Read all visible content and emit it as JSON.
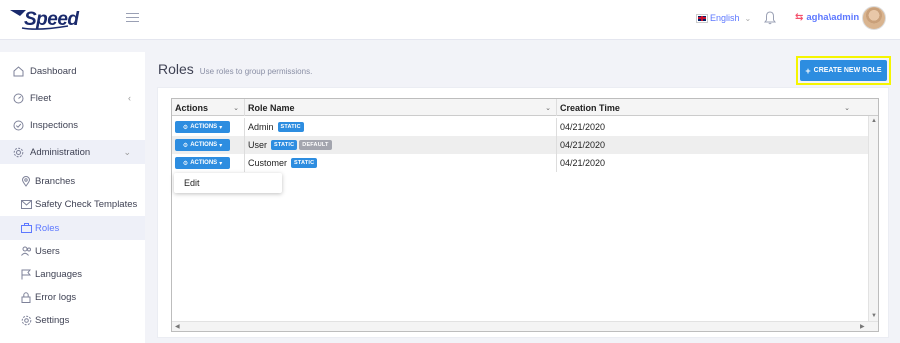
{
  "app": {
    "logo_text": "Speed"
  },
  "header": {
    "language": "English",
    "user": "agha\\admin"
  },
  "sidebar": {
    "items": [
      {
        "label": "Dashboard",
        "icon": "home-icon"
      },
      {
        "label": "Fleet",
        "icon": "speedometer-icon"
      },
      {
        "label": "Inspections",
        "icon": "check-circle-icon"
      },
      {
        "label": "Administration",
        "icon": "gear-icon"
      },
      {
        "label": "Branches",
        "icon": "map-pin-icon"
      },
      {
        "label": "Safety Check Templates",
        "icon": "envelope-icon"
      },
      {
        "label": "Roles",
        "icon": "briefcase-icon"
      },
      {
        "label": "Users",
        "icon": "users-icon"
      },
      {
        "label": "Languages",
        "icon": "flag-icon"
      },
      {
        "label": "Error logs",
        "icon": "lock-icon"
      },
      {
        "label": "Settings",
        "icon": "cog-icon"
      }
    ]
  },
  "page": {
    "title": "Roles",
    "subtitle": "Use roles to group permissions.",
    "create_button": "CREATE NEW ROLE",
    "create_plus": "+"
  },
  "grid": {
    "columns": [
      "Actions",
      "Role Name",
      "Creation Time"
    ],
    "action_label": "ACTIONS",
    "rows": [
      {
        "name": "Admin",
        "badges": [
          "STATIC"
        ],
        "created": "04/21/2020"
      },
      {
        "name": "User",
        "badges": [
          "STATIC",
          "DEFAULT"
        ],
        "created": "04/21/2020"
      },
      {
        "name": "Customer",
        "badges": [
          "STATIC"
        ],
        "created": "04/21/2020"
      }
    ],
    "menu": {
      "edit": "Edit"
    }
  },
  "colors": {
    "primary": "#2d8de0",
    "accent_link": "#5d78ff",
    "highlight_border": "#f5f500",
    "default_badge": "#a3a5ae"
  }
}
